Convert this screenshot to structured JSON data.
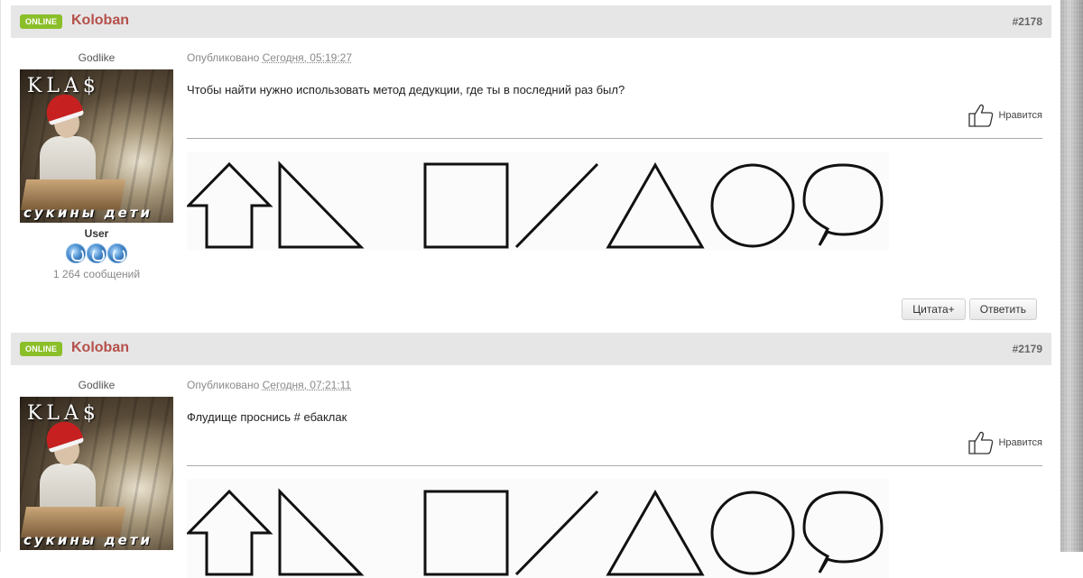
{
  "posts": [
    {
      "status_badge": "ONLINE",
      "author": "Koloban",
      "number": "#2178",
      "rank_title": "Godlike",
      "avatar_text_top": "KLA$",
      "avatar_text_bottom": "сукины дети",
      "group": "User",
      "posts_count": "1 264 сообщений",
      "published_label": "Опубликовано",
      "date": "Сегодня, 05:19:27",
      "text": "Чтобы найти нужно использовать метод дедукции, где ты в последний раз был?",
      "like_label": "Нравится",
      "signature_shapes": [
        "arrow-up",
        "right-triangle",
        "square",
        "diagonal-line",
        "triangle",
        "circle",
        "speech-bubble"
      ],
      "actions": {
        "quote": "Цитата+",
        "reply": "Ответить"
      }
    },
    {
      "status_badge": "ONLINE",
      "author": "Koloban",
      "number": "#2179",
      "rank_title": "Godlike",
      "avatar_text_top": "KLA$",
      "avatar_text_bottom": "сукины дети",
      "published_label": "Опубликовано",
      "date": "Сегодня, 07:21:11",
      "text": "Флудище проснись # ебаклак",
      "like_label": "Нравится",
      "signature_shapes": [
        "arrow-up",
        "right-triangle",
        "square",
        "diagonal-line",
        "triangle",
        "circle",
        "speech-bubble"
      ]
    }
  ],
  "colors": {
    "online_badge": "#8bbf2a",
    "author_name": "#b5504a",
    "header_bg": "#e6e6e6"
  }
}
